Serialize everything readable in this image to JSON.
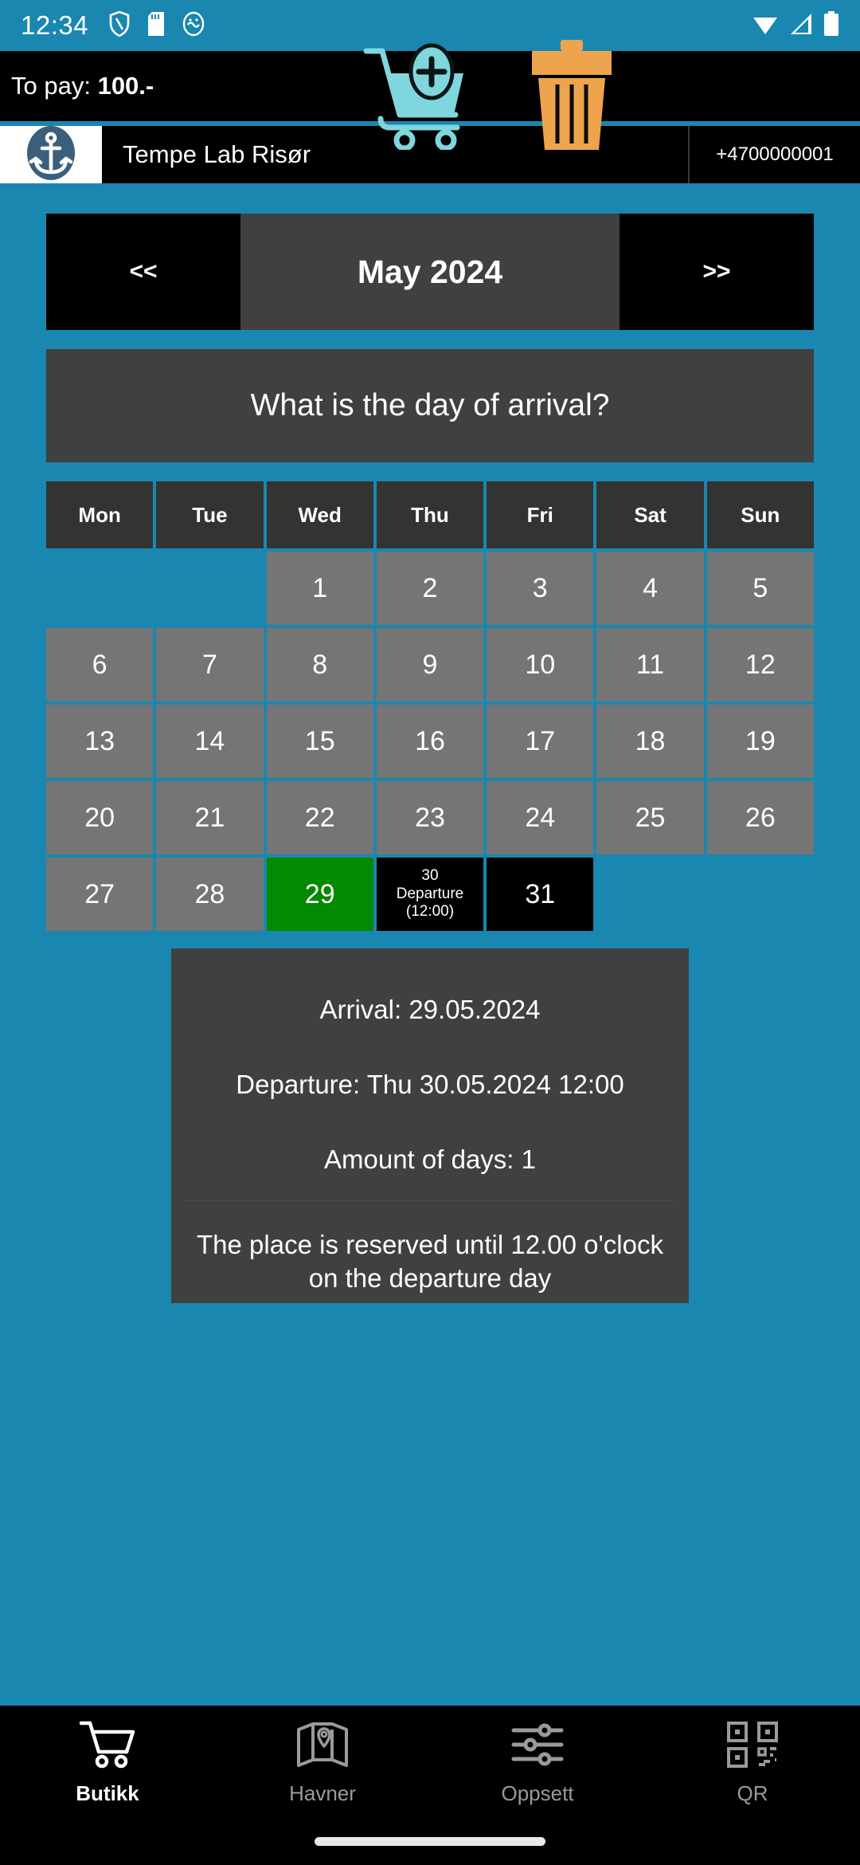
{
  "status_bar": {
    "clock": "12:34",
    "left_icons": [
      "shield-icon",
      "sd-card-icon",
      "app-icon"
    ],
    "right_icons": [
      "wifi-icon",
      "signal-icon",
      "battery-icon"
    ]
  },
  "top_bar": {
    "to_pay_label": "To pay:",
    "to_pay_amount": "100.-",
    "add_to_cart_icon": "add-to-cart-icon",
    "delete_icon": "trash-icon"
  },
  "harbour": {
    "logo_icon": "anchor-icon",
    "name": "Tempe Lab Risør",
    "phone": "+4700000001"
  },
  "calendar": {
    "prev_label": "<<",
    "next_label": ">>",
    "month_title": "May 2024",
    "question": "What is the day of arrival?",
    "weekdays": [
      "Mon",
      "Tue",
      "Wed",
      "Thu",
      "Fri",
      "Sat",
      "Sun"
    ],
    "weeks": [
      [
        {
          "label": "",
          "state": "empty"
        },
        {
          "label": "",
          "state": "empty"
        },
        {
          "label": "1",
          "state": "available"
        },
        {
          "label": "2",
          "state": "available"
        },
        {
          "label": "3",
          "state": "available"
        },
        {
          "label": "4",
          "state": "available"
        },
        {
          "label": "5",
          "state": "available"
        }
      ],
      [
        {
          "label": "6",
          "state": "available"
        },
        {
          "label": "7",
          "state": "available"
        },
        {
          "label": "8",
          "state": "available"
        },
        {
          "label": "9",
          "state": "available"
        },
        {
          "label": "10",
          "state": "available"
        },
        {
          "label": "11",
          "state": "available"
        },
        {
          "label": "12",
          "state": "available"
        }
      ],
      [
        {
          "label": "13",
          "state": "available"
        },
        {
          "label": "14",
          "state": "available"
        },
        {
          "label": "15",
          "state": "available"
        },
        {
          "label": "16",
          "state": "available"
        },
        {
          "label": "17",
          "state": "available"
        },
        {
          "label": "18",
          "state": "available"
        },
        {
          "label": "19",
          "state": "available"
        }
      ],
      [
        {
          "label": "20",
          "state": "available"
        },
        {
          "label": "21",
          "state": "available"
        },
        {
          "label": "22",
          "state": "available"
        },
        {
          "label": "23",
          "state": "available"
        },
        {
          "label": "24",
          "state": "available"
        },
        {
          "label": "25",
          "state": "available"
        },
        {
          "label": "26",
          "state": "available"
        }
      ],
      [
        {
          "label": "27",
          "state": "available"
        },
        {
          "label": "28",
          "state": "available"
        },
        {
          "label": "29",
          "state": "selected"
        },
        {
          "label": "30",
          "state": "departure",
          "sub1": "Departure",
          "sub2": "(12:00)"
        },
        {
          "label": "31",
          "state": "black"
        },
        {
          "label": "",
          "state": "empty"
        },
        {
          "label": "",
          "state": "empty"
        }
      ]
    ]
  },
  "summary": {
    "arrival": "Arrival: 29.05.2024",
    "departure": "Departure: Thu 30.05.2024 12:00",
    "amount_of_days": "Amount of days: 1",
    "note": "The place is reserved until 12.00 o'clock on the departure day"
  },
  "bottom_nav": [
    {
      "label": "Butikk",
      "icon": "shopping-cart-icon",
      "active": true
    },
    {
      "label": "Havner",
      "icon": "map-icon",
      "active": false
    },
    {
      "label": "Oppsett",
      "icon": "sliders-icon",
      "active": false
    },
    {
      "label": "QR",
      "icon": "qr-code-icon",
      "active": false
    }
  ],
  "colors": {
    "accent": "#1a87b0",
    "selected_day": "#038a00",
    "panel": "#404040",
    "day_cell": "#757575",
    "cart_icon": "#7fd6dc",
    "trash_icon": "#eda44c"
  }
}
